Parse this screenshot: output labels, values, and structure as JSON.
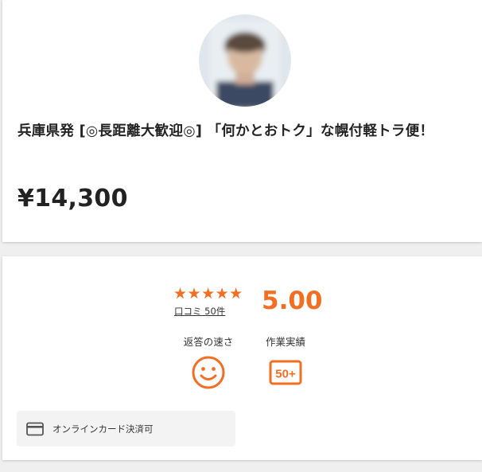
{
  "listing": {
    "title": "兵庫県発 [◎長距離大歓迎◎] 「何かとおトク」な幌付軽トラ便！",
    "price": "¥14,300",
    "avatar_icon": "seller-avatar"
  },
  "rating": {
    "stars_display": "★★★★★",
    "stars": 5,
    "score": "5.00",
    "reviews_label": "口コミ 50件"
  },
  "metrics": [
    {
      "label": "返答の速さ",
      "icon": "smile-face-icon"
    },
    {
      "label": "作業実績",
      "icon": "badge-50plus-icon",
      "badge_text": "50+"
    }
  ],
  "payment": {
    "label": "オンラインカード決済可",
    "icon": "credit-card-icon"
  },
  "colors": {
    "accent": "#f26e22",
    "text": "#222222",
    "background": "#efefef",
    "card": "#ffffff",
    "payment_bg": "#f3f3f3"
  }
}
